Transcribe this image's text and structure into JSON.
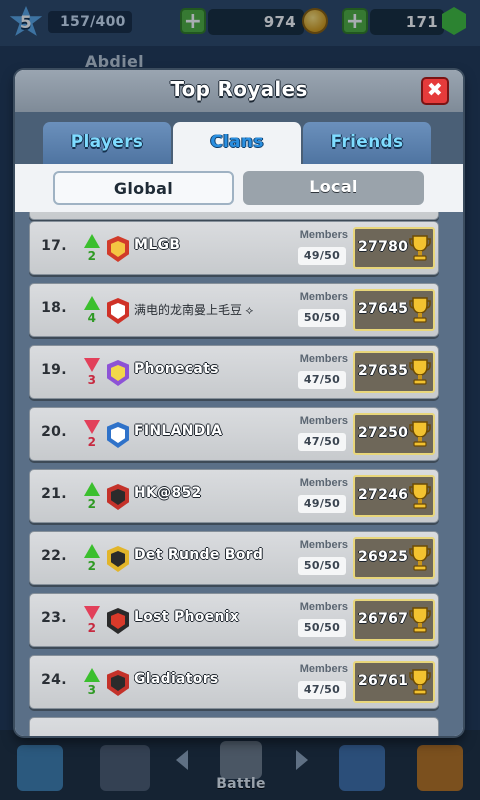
{
  "topbar": {
    "level": "5",
    "xp": "157/400",
    "gold": "974",
    "gems": "171"
  },
  "background": {
    "player_name": "Abdiel"
  },
  "bottom_nav": {
    "battle_label": "Battle"
  },
  "modal": {
    "title": "Top Royales",
    "close_symbol": "✖",
    "tabs": [
      {
        "label": "Players",
        "active": false
      },
      {
        "label": "Clans",
        "active": true
      },
      {
        "label": "Friends",
        "active": false
      }
    ],
    "scope": {
      "global_label": "Global",
      "local_label": "Local",
      "selected": "Global"
    }
  },
  "clans": {
    "members_label": "Members",
    "rows": [
      {
        "rank": "17.",
        "trend": "up",
        "change": "2",
        "name": "MLGB",
        "members": "49/50",
        "trophies": "27780",
        "badge_color": "#d13b2a",
        "badge_inner": "#f4c542"
      },
      {
        "rank": "18.",
        "trend": "up",
        "change": "4",
        "name": "满电的龙南曼上毛豆 ⟡",
        "members": "50/50",
        "trophies": "27645",
        "badge_color": "#cf3127",
        "badge_inner": "#ffffff"
      },
      {
        "rank": "19.",
        "trend": "down",
        "change": "3",
        "name": "Phonecats",
        "members": "47/50",
        "trophies": "27635",
        "badge_color": "#8d53d6",
        "badge_inner": "#f2d84a"
      },
      {
        "rank": "20.",
        "trend": "down",
        "change": "2",
        "name": "FINLANDIA",
        "members": "47/50",
        "trophies": "27250",
        "badge_color": "#2f72c9",
        "badge_inner": "#ffffff"
      },
      {
        "rank": "21.",
        "trend": "up",
        "change": "2",
        "name": "HK@852",
        "members": "49/50",
        "trophies": "27246",
        "badge_color": "#c4322a",
        "badge_inner": "#2b2b2b"
      },
      {
        "rank": "22.",
        "trend": "up",
        "change": "2",
        "name": "Det Runde Bord",
        "members": "50/50",
        "trophies": "26925",
        "badge_color": "#e2b52a",
        "badge_inner": "#2b2b2b"
      },
      {
        "rank": "23.",
        "trend": "down",
        "change": "2",
        "name": "Lost Phoenix",
        "members": "50/50",
        "trophies": "26767",
        "badge_color": "#2a2a2a",
        "badge_inner": "#d93a2a"
      },
      {
        "rank": "24.",
        "trend": "up",
        "change": "3",
        "name": "Gladiators",
        "members": "47/50",
        "trophies": "26761",
        "badge_color": "#c4322a",
        "badge_inner": "#2b2b2b"
      }
    ]
  },
  "colors": {
    "up": "#3bbf2e",
    "down": "#e2405a",
    "accent_tab": "#2a8fe0"
  }
}
